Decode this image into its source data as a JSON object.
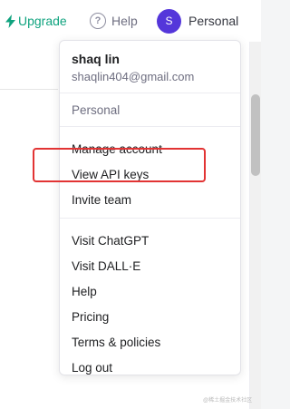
{
  "topbar": {
    "upgrade_label": "Upgrade",
    "help_label": "Help",
    "help_glyph": "?",
    "account_label": "Personal",
    "avatar_initial": "S"
  },
  "menu": {
    "user_name": "shaq lin",
    "user_email": "shaqlin404@gmail.com",
    "org_label": "Personal",
    "items_group1": [
      "Manage account",
      "View API keys",
      "Invite team"
    ],
    "items_group2": [
      "Visit ChatGPT",
      "Visit DALL·E",
      "Help",
      "Pricing",
      "Terms & policies",
      "Log out"
    ]
  },
  "annotation": {
    "color": "#e23434",
    "target": "View API keys"
  },
  "watermark": "@稀土掘金技术社区",
  "colors": {
    "accent": "#10a37f",
    "avatar": "#5436da"
  }
}
